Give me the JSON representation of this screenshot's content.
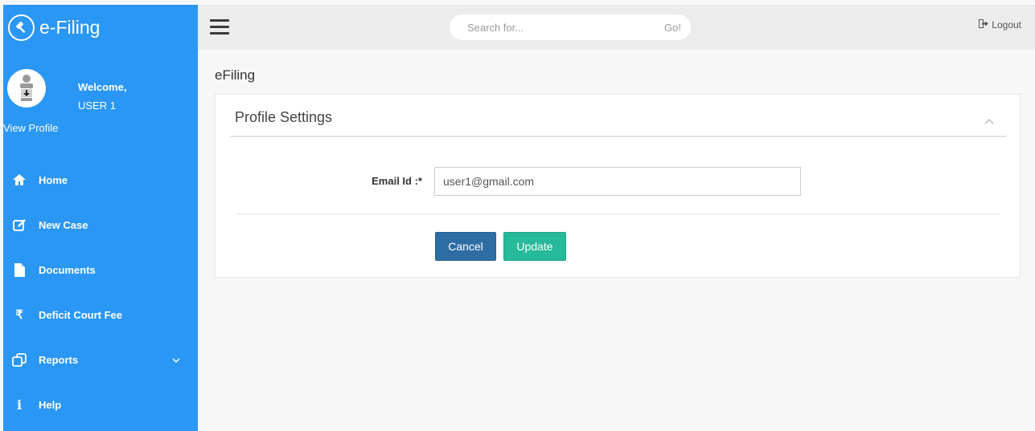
{
  "brand": {
    "title": "e-Filing"
  },
  "profile": {
    "welcome": "Welcome,",
    "username": "USER 1",
    "view_profile": "View Profile"
  },
  "nav": {
    "items": [
      {
        "label": "Home",
        "icon": "home-icon"
      },
      {
        "label": "New Case",
        "icon": "edit-icon"
      },
      {
        "label": "Documents",
        "icon": "file-icon"
      },
      {
        "label": "Deficit Court Fee",
        "icon": "rupee-icon"
      },
      {
        "label": "Reports",
        "icon": "copy-icon",
        "has_submenu": true
      },
      {
        "label": "Help",
        "icon": "info-icon"
      }
    ]
  },
  "topbar": {
    "search_placeholder": "Search for...",
    "search_button": "Go!",
    "logout": "Logout"
  },
  "page": {
    "heading": "eFiling"
  },
  "card": {
    "title": "Profile Settings",
    "email_label": "Email Id :*",
    "email_value": "user1@gmail.com",
    "cancel_label": "Cancel",
    "update_label": "Update"
  },
  "colors": {
    "sidebar": "#2a97f5",
    "cancel_button": "#2e6da4",
    "update_button": "#26b99a",
    "topbar": "#ececec"
  }
}
